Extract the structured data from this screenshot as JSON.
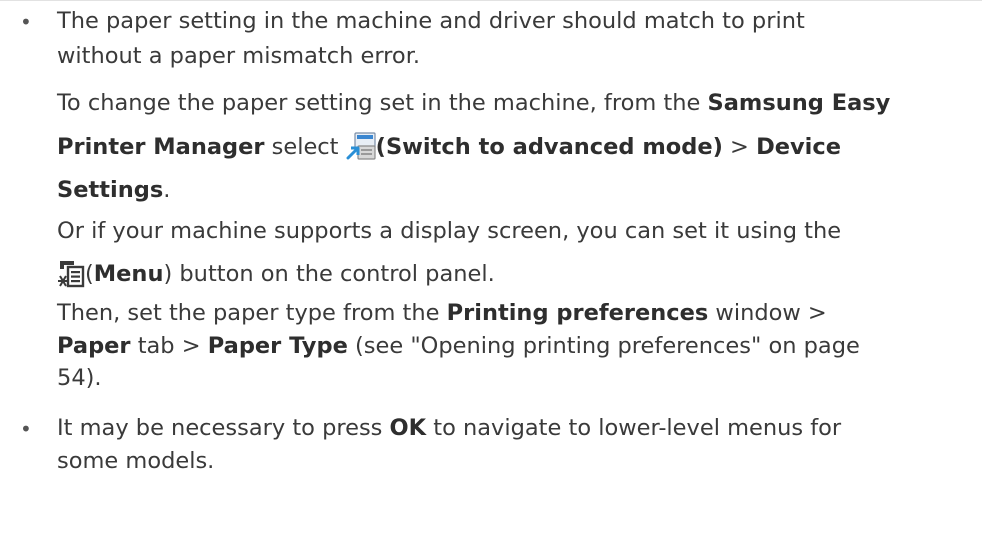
{
  "bullets": [
    {
      "line1": "The paper setting in the machine and driver should match to print",
      "line2": "without a paper mismatch error."
    },
    {
      "line1": "It may be necessary to press ",
      "ok": "OK",
      "line1_after": " to navigate to lower-level menus for",
      "line2": "some models."
    }
  ],
  "para_change": {
    "text1": "To change the paper setting set in the machine, from the ",
    "samsung_easy": "Samsung Easy",
    "printer_manager": "Printer Manager",
    "select": " select ",
    "switch": "(Switch to advanced mode)",
    "gt": " > ",
    "device": "Device",
    "settings": "Settings",
    "period": "."
  },
  "para_display": {
    "text1": "Or if your machine supports a display screen, you can set it using the",
    "open_paren": "(",
    "menu": "Menu",
    "close_rest": ") button on the control panel."
  },
  "para_then": {
    "text1": "Then, set the paper type from the ",
    "printing_prefs": "Printing preferences",
    "window": " window >",
    "paper": "Paper",
    "tab": " tab > ",
    "paper_type": "Paper Type",
    "see": " (see \"Opening printing preferences\" on page",
    "page": "54)."
  },
  "icons": {
    "advanced_mode": "switch-to-advanced-mode-icon",
    "menu": "menu-button-icon"
  },
  "colors": {
    "text": "#3a3a3a",
    "icon_blue": "#2a8fd6",
    "icon_gray": "#8a8a8a"
  }
}
